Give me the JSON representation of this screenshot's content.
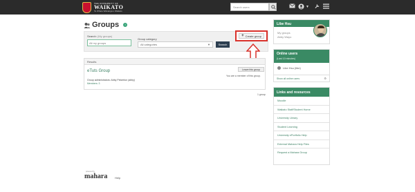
{
  "header": {
    "logo": {
      "top": "THE UNIVERSITY OF",
      "main": "WAIKATO",
      "sub": "Te Whare Wānanga o Waikato"
    },
    "search_placeholder": "Search users",
    "icons": [
      "search-icon",
      "envelope-icon",
      "user-icon",
      "chevron-down-icon",
      "wrench-icon",
      "menu-icon"
    ]
  },
  "main": {
    "title": "Groups",
    "info_badge": "i",
    "filter": {
      "search_label": "Search:",
      "search_hint": "(My groups)",
      "search_value": "All my groups",
      "category_label": "Group category",
      "category_value": "All categories",
      "search_button": "Search"
    },
    "create_group_label": "Create group",
    "results": {
      "header": "Results",
      "group_name": "eTuts Group",
      "leave_label": "Leave this group",
      "member_note": "You are a member of this group.",
      "admin_line": "Group administrators: Abby Pinkerton (abby)",
      "members_line": "Members: 3"
    },
    "group_count": "1 group"
  },
  "sidebar": {
    "user": {
      "name": "Libe Hsu",
      "links": [
        "My groups",
        "Abby Wayo"
      ]
    },
    "online": {
      "title": "Online users",
      "subtitle": "(Last 10 minutes)",
      "user": "Libe Hsu (libe)",
      "show_all": "Show all online users"
    },
    "links": {
      "title": "Links and resources",
      "items": [
        "Moodle",
        "Waikato Staff/Student Home",
        "University Library",
        "Student Learning",
        "University ePortfolio Help",
        "External Mahara Help Files",
        "Request a Mahara Group"
      ]
    }
  },
  "footer": {
    "powered": "powered by",
    "logo": "mahara",
    "help": "Help"
  },
  "colors": {
    "header_bg": "#2b2b2b",
    "accent_green": "#3a8a64",
    "highlight_red": "#d9312b",
    "search_btn": "#2c3e50"
  }
}
